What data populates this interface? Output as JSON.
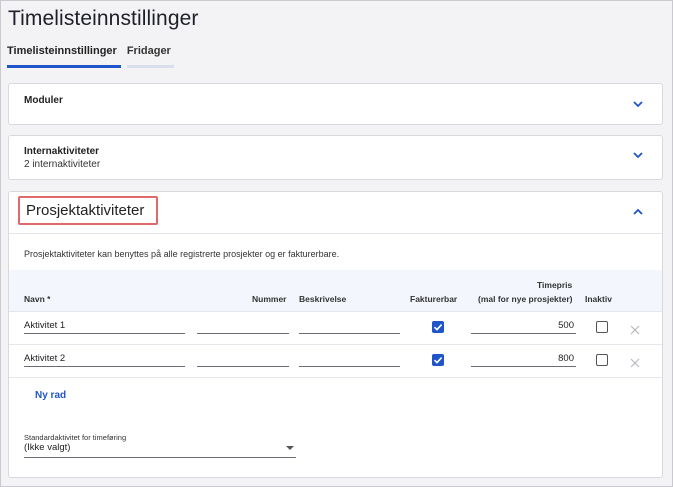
{
  "page": {
    "title": "Timelisteinnstillinger"
  },
  "tabs": [
    {
      "label": "Timelisteinnstillinger",
      "active": true
    },
    {
      "label": "Fridager",
      "active": false
    }
  ],
  "sections": {
    "moduler": {
      "title": "Moduler",
      "icon": "chevron-down-icon"
    },
    "internaktiviteter": {
      "title": "Internaktiviteter",
      "subtitle": "2 internaktiviteter",
      "icon": "chevron-down-icon"
    },
    "prosjektaktiviteter": {
      "title": "Prosjektaktiviteter",
      "icon": "chevron-up-icon",
      "description": "Prosjektaktiviteter kan benyttes på alle registrerte prosjekter og er fakturerbare.",
      "columns": {
        "navn": "Navn *",
        "nummer": "Nummer",
        "beskrivelse": "Beskrivelse",
        "fakturerbar": "Fakturerbar",
        "timepris_line1": "Timepris",
        "timepris_line2": "(mal for nye prosjekter)",
        "inaktiv": "Inaktiv"
      },
      "rows": [
        {
          "navn": "Aktivitet 1",
          "nummer": "",
          "beskrivelse": "",
          "fakturerbar": true,
          "timepris": "500",
          "inaktiv": false
        },
        {
          "navn": "Aktivitet 2",
          "nummer": "",
          "beskrivelse": "",
          "fakturerbar": true,
          "timepris": "800",
          "inaktiv": false
        }
      ],
      "add_row_label": "Ny rad",
      "default_activity": {
        "label": "Standardaktivitet for timeføring",
        "value": "(Ikke valgt)"
      }
    }
  },
  "colors": {
    "accent": "#1f55c9",
    "highlight": "#e06a6a"
  }
}
